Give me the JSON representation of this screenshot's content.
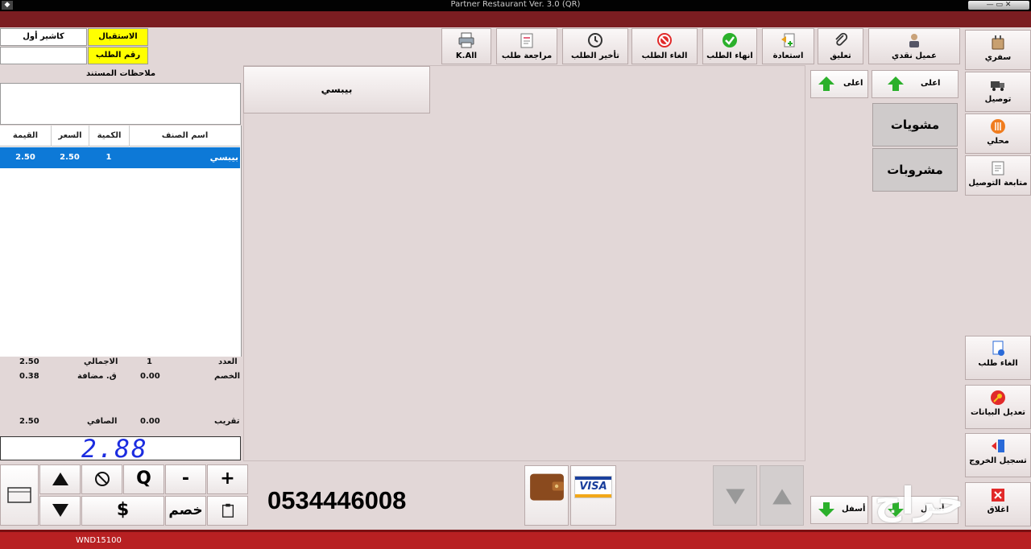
{
  "window": {
    "title": "Partner Restaurant Ver. 3.0 (QR)"
  },
  "header": {
    "cashier_label": "الاستقبال",
    "cashier_value": "كاشير أول",
    "order_no_label": "رقم الطلب",
    "order_no_value": ""
  },
  "toolbar": {
    "kall": "K.All",
    "review": "مراجعة طلب",
    "delay": "تأخير الطلب",
    "cancel": "الغاء الطلب",
    "finish": "انهاء الطلب",
    "restore": "استعادة",
    "suspend": "تعليق",
    "cash_customer": "عميل نقدي"
  },
  "sidebar": {
    "items": [
      {
        "label": "سفري",
        "icon": "takeaway-icon"
      },
      {
        "label": "توصيل",
        "icon": "delivery-truck-icon"
      },
      {
        "label": "محلي",
        "icon": "dine-in-icon"
      },
      {
        "label": "متابعة التوصيل",
        "icon": "delivery-tracking-icon"
      },
      {
        "label": "الغاء طلب",
        "icon": "cancel-order-icon"
      },
      {
        "label": "تعديل البيانات",
        "icon": "key-icon"
      },
      {
        "label": "تسجيل الخروج",
        "icon": "logout-icon"
      },
      {
        "label": "اغلاق",
        "icon": "close-icon"
      }
    ]
  },
  "categories": {
    "up_label": "اعلى",
    "down_label": "أسفل",
    "items": [
      "مشويات",
      "مشروبات"
    ]
  },
  "products": {
    "up_label": "اعلى",
    "down_label": "أسفل",
    "items": [
      "بيبسي"
    ]
  },
  "notes": {
    "label": "ملاحظات المستند",
    "value": ""
  },
  "grid": {
    "columns": [
      "اسم الصنف",
      "الكمية",
      "السعر",
      "القيمة"
    ],
    "rows": [
      {
        "name": "بيبسي",
        "qty": "1",
        "price": "2.50",
        "value": "2.50"
      }
    ]
  },
  "totals": {
    "count_label": "العدد",
    "count_value": "1",
    "total_label": "الاجمالي",
    "total_value": "2.50",
    "discount_label": "الخصم",
    "discount_value": "0.00",
    "vat_label": "ق. مضافة",
    "vat_value": "0.38",
    "rounding_label": "تقريب",
    "rounding_value": "0.00",
    "net_label": "الصافي",
    "net_value": "2.50"
  },
  "display": {
    "amount": "2.88"
  },
  "keypad": {
    "discount": "خصم",
    "plus": "+",
    "minus": "-",
    "q": "Q",
    "dollar": "$"
  },
  "phone": "0534446008",
  "payment": {
    "visa": "VISA"
  },
  "watermark": "حراج",
  "statusbar": {
    "code": "WND15100"
  },
  "colors": {
    "accent_red": "#b82022",
    "selection_blue": "#0d79d7",
    "label_yellow": "#ffff00",
    "display_blue": "#1b2ce0"
  }
}
